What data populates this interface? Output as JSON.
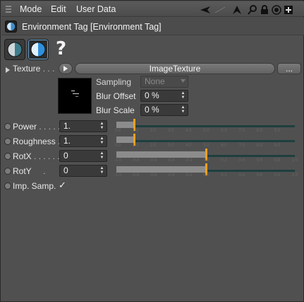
{
  "menu": {
    "items": [
      "Mode",
      "Edit",
      "User Data"
    ]
  },
  "toolbar_icons": [
    "back-arrow-icon",
    "forward-arrow-icon",
    "up-arrow-icon",
    "search-icon",
    "lock-icon",
    "target-icon",
    "new-window-icon"
  ],
  "header": {
    "title": "Environment Tag [Environment Tag]"
  },
  "help_label": "?",
  "texture": {
    "label": "Texture",
    "dots": " . . .",
    "shader_name": "ImageTexture",
    "more_button": "...",
    "sampling_label": "Sampling",
    "sampling_value": "None",
    "blur_offset_label": "Blur Offset",
    "blur_offset_value": "0 %",
    "blur_scale_label": "Blur Scale",
    "blur_scale_value": "0 %"
  },
  "params": [
    {
      "label": "Power",
      "dots": " . . . . .",
      "value": "1.",
      "fraction": 0.1
    },
    {
      "label": "Roughness",
      "dots": " .",
      "value": "1.",
      "fraction": 0.1
    },
    {
      "label": "RotX",
      "dots": " . . . . . .",
      "value": "0",
      "fraction": 0.5
    },
    {
      "label": "RotY",
      "dots": "     .",
      "value": "0",
      "fraction": 0.5
    }
  ],
  "ticks_0_10": [
    "0.0",
    "1.0",
    "2.0",
    "3.0",
    "4.0",
    "5.0",
    "6.0",
    "7.0",
    "8.0",
    "9.0"
  ],
  "ticks_pm1": [
    "-1.0",
    "-0.8",
    "-0.6",
    "-0.4",
    "-0.2",
    "0.0",
    "0.2",
    "0.4",
    "0.6",
    "0.8",
    "1.0"
  ],
  "imp_samp": {
    "label": "Imp. Samp.",
    "checked": "✓"
  },
  "colors": {
    "accent": "#f0a020",
    "track": "#1e3f3f",
    "panel": "#505050"
  }
}
